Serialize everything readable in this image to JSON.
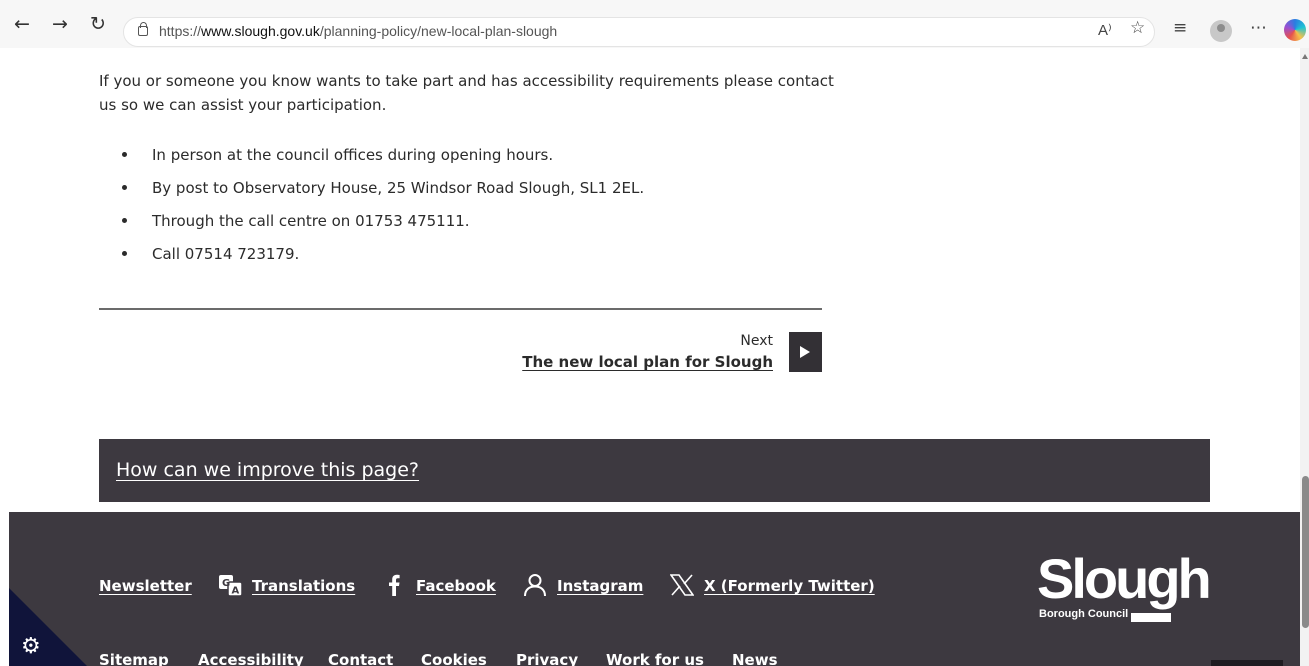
{
  "browser": {
    "url_prefix": "https://",
    "url_domain": "www.slough.gov.uk",
    "url_path": "/planning-policy/new-local-plan-slough",
    "read_aloud_label": "A⁾",
    "icons": [
      "back-icon",
      "forward-icon",
      "refresh-icon",
      "lock-icon",
      "read-aloud-icon",
      "favorite-star-icon",
      "favorites-list-icon",
      "profile-icon",
      "more-icon",
      "copilot-icon"
    ]
  },
  "content": {
    "intro": "If you or someone you know wants to take part and has accessibility requirements please contact us so we can assist your participation.",
    "bullets": [
      "In person at the council offices during opening hours.",
      "By post to Observatory House, 25 Windsor Road Slough, SL1 2EL.",
      "Through the call centre on 01753 475111.",
      "Call 07514 723179."
    ],
    "next_label": "Next",
    "next_link": "The new local plan for Slough"
  },
  "feedback": {
    "link": "How can we improve this page?"
  },
  "footer": {
    "social": {
      "newsletter": "Newsletter",
      "translations": "Translations",
      "facebook": "Facebook",
      "instagram": "Instagram",
      "x": "X (Formerly Twitter)"
    },
    "bottom_links": [
      "Sitemap",
      "Accessibility",
      "Contact",
      "Cookies",
      "Privacy",
      "Work for us",
      "News"
    ],
    "logo": {
      "word": "Slough",
      "sub": "Borough Council"
    }
  },
  "colors": {
    "footer_bg": "#3d3940",
    "cookie_triangle": "#10143a",
    "text": "#2b2b2b"
  }
}
